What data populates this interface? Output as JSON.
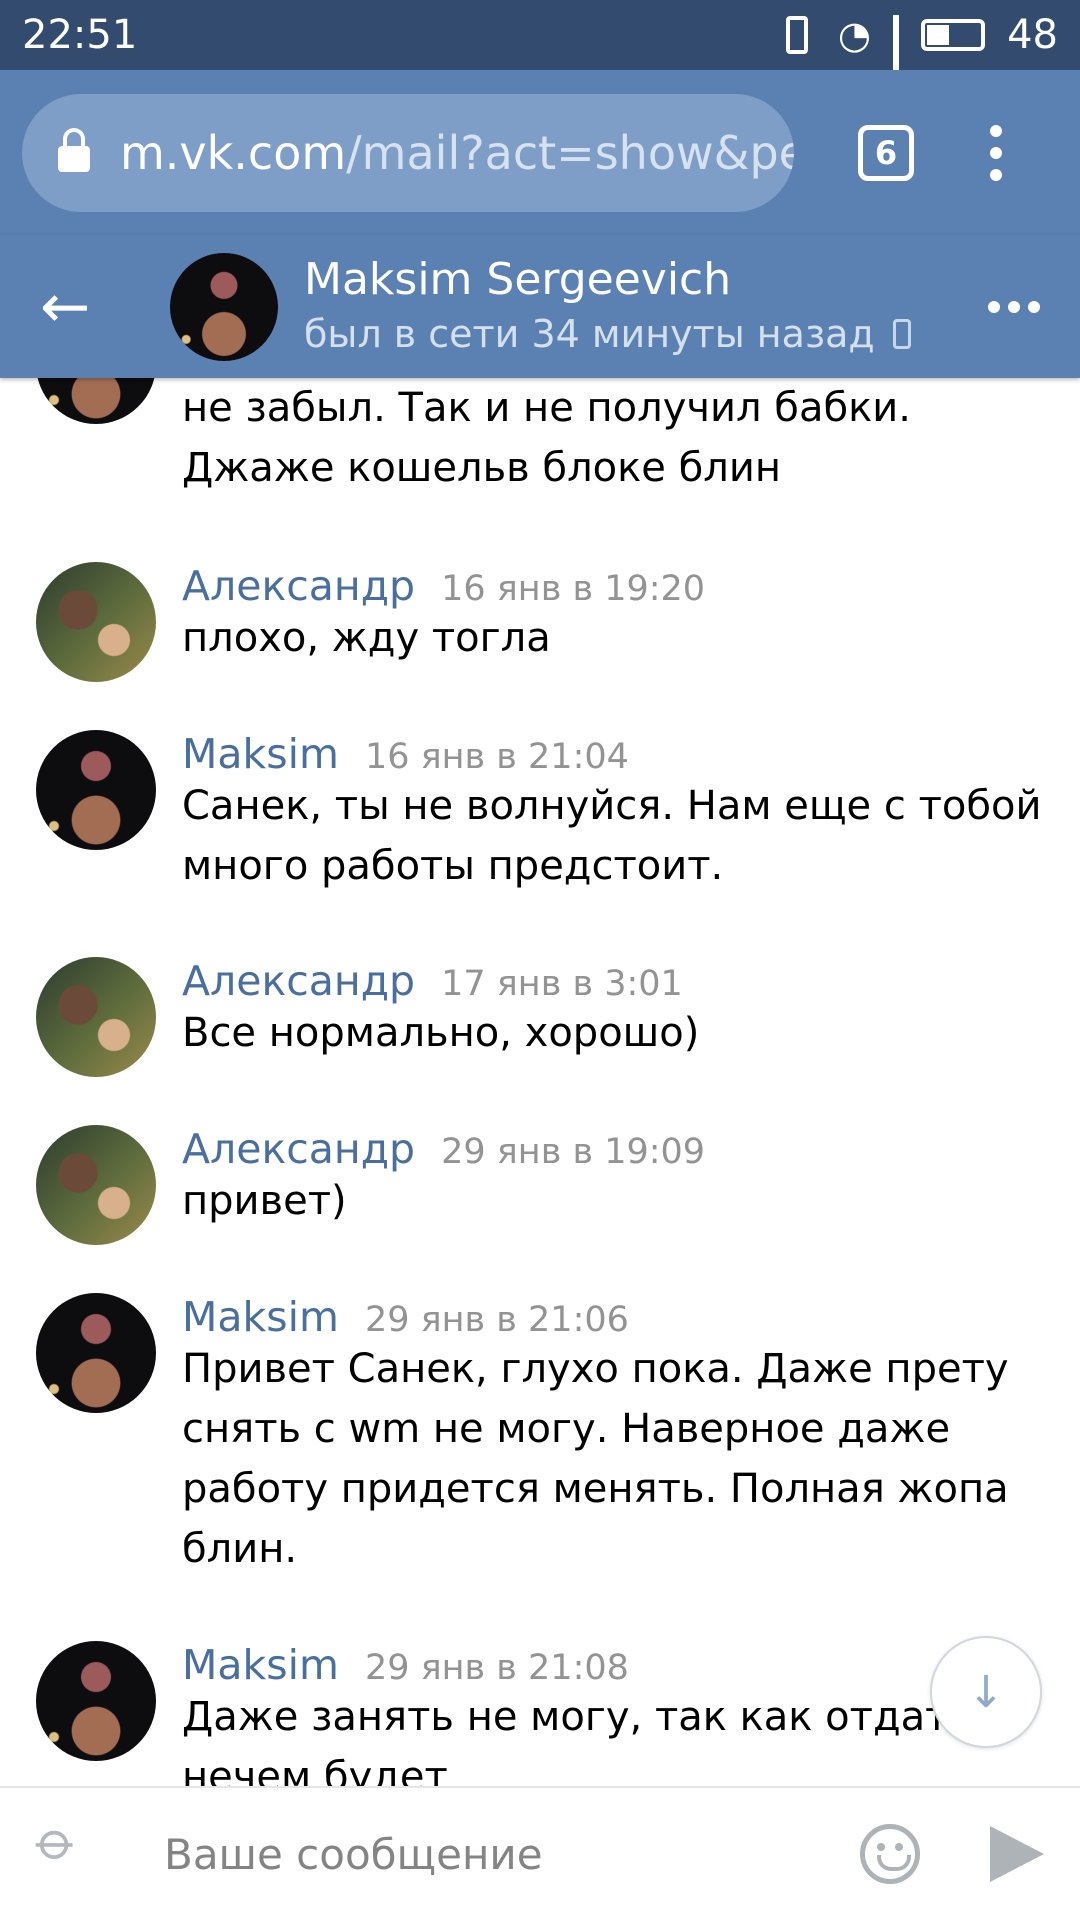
{
  "statusbar": {
    "time": "22:51",
    "network": "3G",
    "battery": "48"
  },
  "browser": {
    "url_host": "m.vk.com",
    "url_path": "/mail?act=show&pe",
    "tabs_count": "6"
  },
  "chat": {
    "name": "Maksim Sergeevich",
    "status": "был в сети 34 минуты назад"
  },
  "messages": [
    {
      "body": "Привет Не Санек, обижаешь. Конечно не забыл. Так и не получил бабки. Джаже кошельв блоке блин"
    },
    {
      "author": "Александр",
      "time": "16 янв в 19:20",
      "body": "плохо, жду тогла"
    },
    {
      "author": "Maksim",
      "time": "16 янв в 21:04",
      "body": "Санек, ты не волнуйся. Нам еще с тобой много работы предстоит."
    },
    {
      "author": "Александр",
      "time": "17 янв в 3:01",
      "body": "Все нормально, хорошо)"
    },
    {
      "author": "Александр",
      "time": "29 янв в 19:09",
      "body": "привет)"
    },
    {
      "author": "Maksim",
      "time": "29 янв в 21:06",
      "body": "Привет Санек, глухо пока. Даже прету снять с wm не могу. Наверное даже работу придется менять. Полная жопа блин."
    },
    {
      "author": "Maksim",
      "time": "29 янв в 21:08",
      "body": "Даже занять не могу, так как отдать нечем будет"
    }
  ],
  "composer": {
    "placeholder": "Ваше сообщение"
  }
}
